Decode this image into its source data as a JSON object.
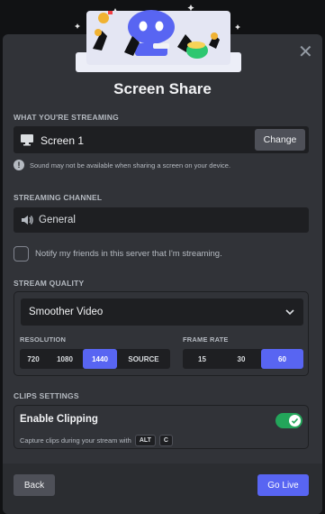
{
  "modal": {
    "title": "Screen Share",
    "close_icon": "close-icon"
  },
  "streaming": {
    "label": "What you're streaming",
    "source_name": "Screen 1",
    "source_icon": "monitor-icon",
    "change_label": "Change",
    "warning": "Sound may not be available when sharing a screen on your device."
  },
  "channel": {
    "label": "Streaming Channel",
    "name": "General",
    "icon": "speaker-icon"
  },
  "notify": {
    "label": "Notify my friends in this server that I'm streaming.",
    "checked": false
  },
  "quality": {
    "label": "Stream Quality",
    "selected": "Smoother Video",
    "resolution_label": "Resolution",
    "resolution_options": [
      "720",
      "1080",
      "1440",
      "Source"
    ],
    "resolution_selected": "1440",
    "framerate_label": "Frame Rate",
    "framerate_options": [
      "15",
      "30",
      "60"
    ],
    "framerate_selected": "60"
  },
  "clips": {
    "label": "Clips Settings",
    "title": "Enable Clipping",
    "enabled": true,
    "description": "Capture clips during your stream with",
    "keys": [
      "ALT",
      "C"
    ]
  },
  "footer": {
    "back_label": "Back",
    "go_live_label": "Go Live"
  },
  "colors": {
    "background": "#313338",
    "footer": "#2b2d31",
    "field": "#1e1f22",
    "accent": "#5865f2",
    "toggle_on": "#23a55a"
  }
}
